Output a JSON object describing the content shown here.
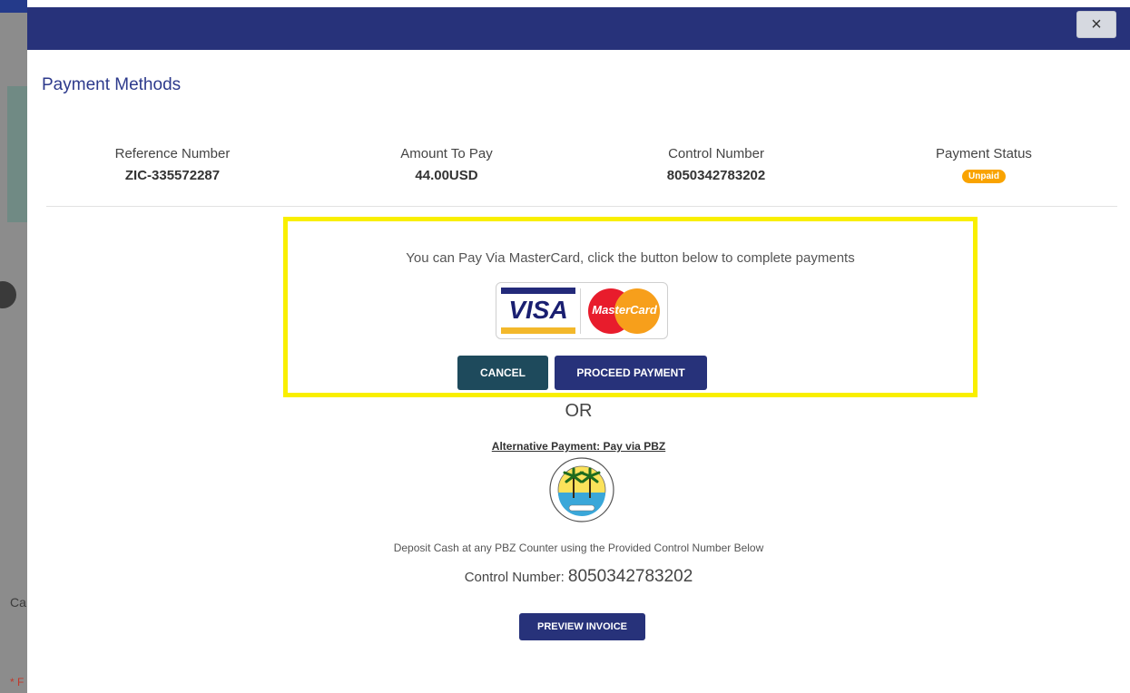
{
  "background": {
    "partial_text_1": "Ca",
    "partial_text_2": "* F"
  },
  "modal": {
    "close_label": "×",
    "title": "Payment Methods"
  },
  "summary": {
    "reference_label": "Reference Number",
    "reference_value": "ZIC-335572287",
    "amount_label": "Amount To Pay",
    "amount_value": "44.00USD",
    "control_label": "Control Number",
    "control_value": "8050342783202",
    "status_label": "Payment Status",
    "status_value": "Unpaid"
  },
  "mastercard": {
    "instruction": "You can Pay Via MasterCard, click the button below to complete payments",
    "visa_logo_text": "VISA",
    "mastercard_logo_text": "MasterCard",
    "cancel_label": "CANCEL",
    "proceed_label": "PROCEED PAYMENT"
  },
  "alternative": {
    "or_label": "OR",
    "title": "Alternative Payment: Pay via PBZ",
    "deposit_instruction": "Deposit Cash at any PBZ Counter using the Provided Control Number Below",
    "control_number_label": "Control Number:",
    "control_number_value": "8050342783202",
    "preview_label": "PREVIEW INVOICE"
  },
  "colors": {
    "header": "#27327a",
    "highlight": "#f9ef00",
    "status_badge": "#f9a300",
    "cancel_button": "#1e4a5c"
  },
  "icons": {
    "close": "close-icon",
    "card_logos": "visa-mastercard-logo",
    "bank_logo": "pbz-logo"
  }
}
